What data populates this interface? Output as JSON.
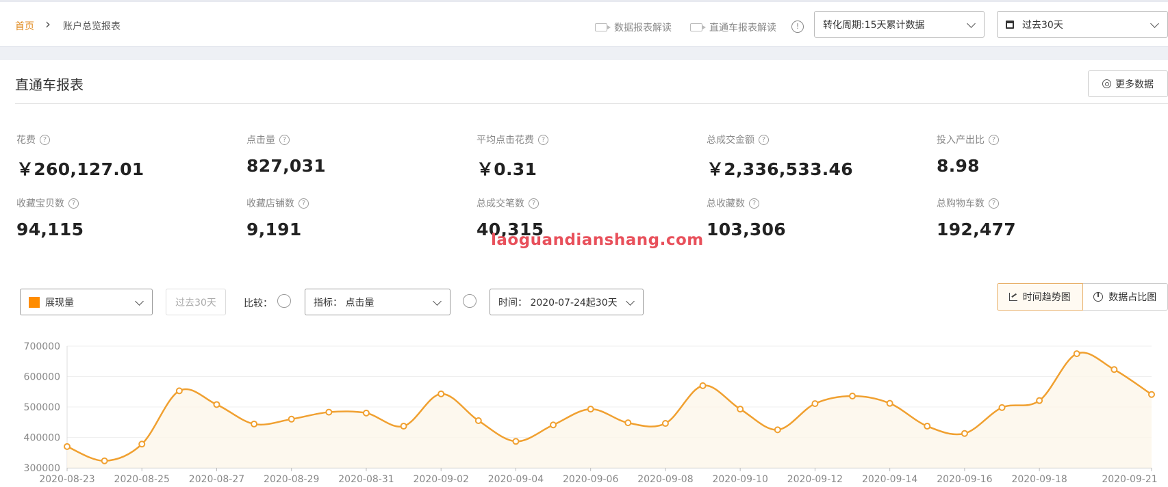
{
  "breadcrumb": {
    "home": "首页",
    "separator": "›",
    "current": "账户总览报表"
  },
  "header": {
    "help_links": [
      {
        "label": "数据报表解读",
        "icon": "video-camera-icon"
      },
      {
        "label": "直通车报表解读",
        "icon": "video-camera-icon"
      }
    ],
    "info_icon": "!",
    "conversion_select": "转化周期:15天累计数据",
    "date_select": "过去30天"
  },
  "section": {
    "title": "直通车报表",
    "more_button": "更多数据",
    "help_glyph": "?"
  },
  "metrics": [
    {
      "label": "花费",
      "value": "￥260,127.01"
    },
    {
      "label": "点击量",
      "value": "827,031"
    },
    {
      "label": "平均点击花费",
      "value": "￥0.31"
    },
    {
      "label": "总成交金额",
      "value": "￥2,336,533.46"
    },
    {
      "label": "投入产出比",
      "value": "8.98"
    },
    {
      "label": "收藏宝贝数",
      "value": "94,115"
    },
    {
      "label": "收藏店铺数",
      "value": "9,191"
    },
    {
      "label": "总成交笔数",
      "value": "40,315"
    },
    {
      "label": "总收藏数",
      "value": "103,306"
    },
    {
      "label": "总购物车数",
      "value": "192,477"
    }
  ],
  "watermark": "laoguandianshang.com",
  "controls": {
    "metric_select": "展现量",
    "metric_color": "#ff8c00",
    "period_disabled": "过去30天",
    "compare_label": "比较：",
    "indicator_select": "指标： 点击量",
    "time_select": "时间： 2020-07-24起30天"
  },
  "view_tabs": {
    "trend": "时间趋势图",
    "share": "数据占比图"
  },
  "chart_data": {
    "type": "line",
    "area_fill": true,
    "smooth": true,
    "line_color": "#f0a030",
    "x": [
      "2020-08-23",
      "2020-08-24",
      "2020-08-25",
      "2020-08-26",
      "2020-08-27",
      "2020-08-28",
      "2020-08-29",
      "2020-08-30",
      "2020-08-31",
      "2020-09-01",
      "2020-09-02",
      "2020-09-03",
      "2020-09-04",
      "2020-09-05",
      "2020-09-06",
      "2020-09-07",
      "2020-09-08",
      "2020-09-09",
      "2020-09-10",
      "2020-09-11",
      "2020-09-12",
      "2020-09-13",
      "2020-09-14",
      "2020-09-15",
      "2020-09-16",
      "2020-09-17",
      "2020-09-18",
      "2020-09-19",
      "2020-09-20",
      "2020-09-21"
    ],
    "x_tick_labels": [
      "2020-08-23",
      "2020-08-25",
      "2020-08-27",
      "2020-08-29",
      "2020-08-31",
      "2020-09-02",
      "2020-09-04",
      "2020-09-06",
      "2020-09-08",
      "2020-09-10",
      "2020-09-12",
      "2020-09-14",
      "2020-09-16",
      "2020-09-18",
      "2020-09-21"
    ],
    "values": [
      370000,
      323000,
      378000,
      553000,
      508000,
      444000,
      460000,
      483000,
      480000,
      437000,
      543000,
      455000,
      387000,
      441000,
      493000,
      448000,
      446000,
      570000,
      493000,
      425000,
      511000,
      536000,
      512000,
      437000,
      413000,
      498000,
      521000,
      675000,
      623000,
      541000
    ],
    "y_ticks": [
      300000,
      400000,
      500000,
      600000,
      700000
    ],
    "ylim": [
      300000,
      700000
    ],
    "grid": true,
    "xlabel": "",
    "ylabel": "",
    "title": ""
  }
}
